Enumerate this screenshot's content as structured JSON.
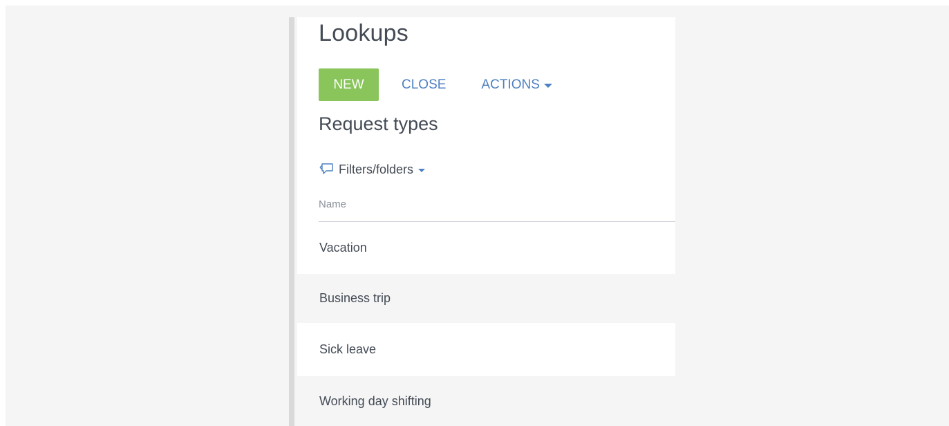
{
  "page": {
    "title": "Lookups"
  },
  "toolbar": {
    "new_label": "NEW",
    "close_label": "CLOSE",
    "actions_label": "ACTIONS"
  },
  "section": {
    "title": "Request types",
    "filters_label": "Filters/folders"
  },
  "table": {
    "columns": [
      "Name"
    ],
    "rows": [
      {
        "name": "Vacation"
      },
      {
        "name": "Business trip"
      },
      {
        "name": "Sick leave"
      },
      {
        "name": "Working day shifting"
      }
    ]
  },
  "colors": {
    "accent_green": "#8ac55b",
    "link_blue": "#4f81c2",
    "text": "#444b55"
  },
  "icons": {
    "filter": "filter-icon",
    "actions_caret": "chevron-down-icon"
  }
}
